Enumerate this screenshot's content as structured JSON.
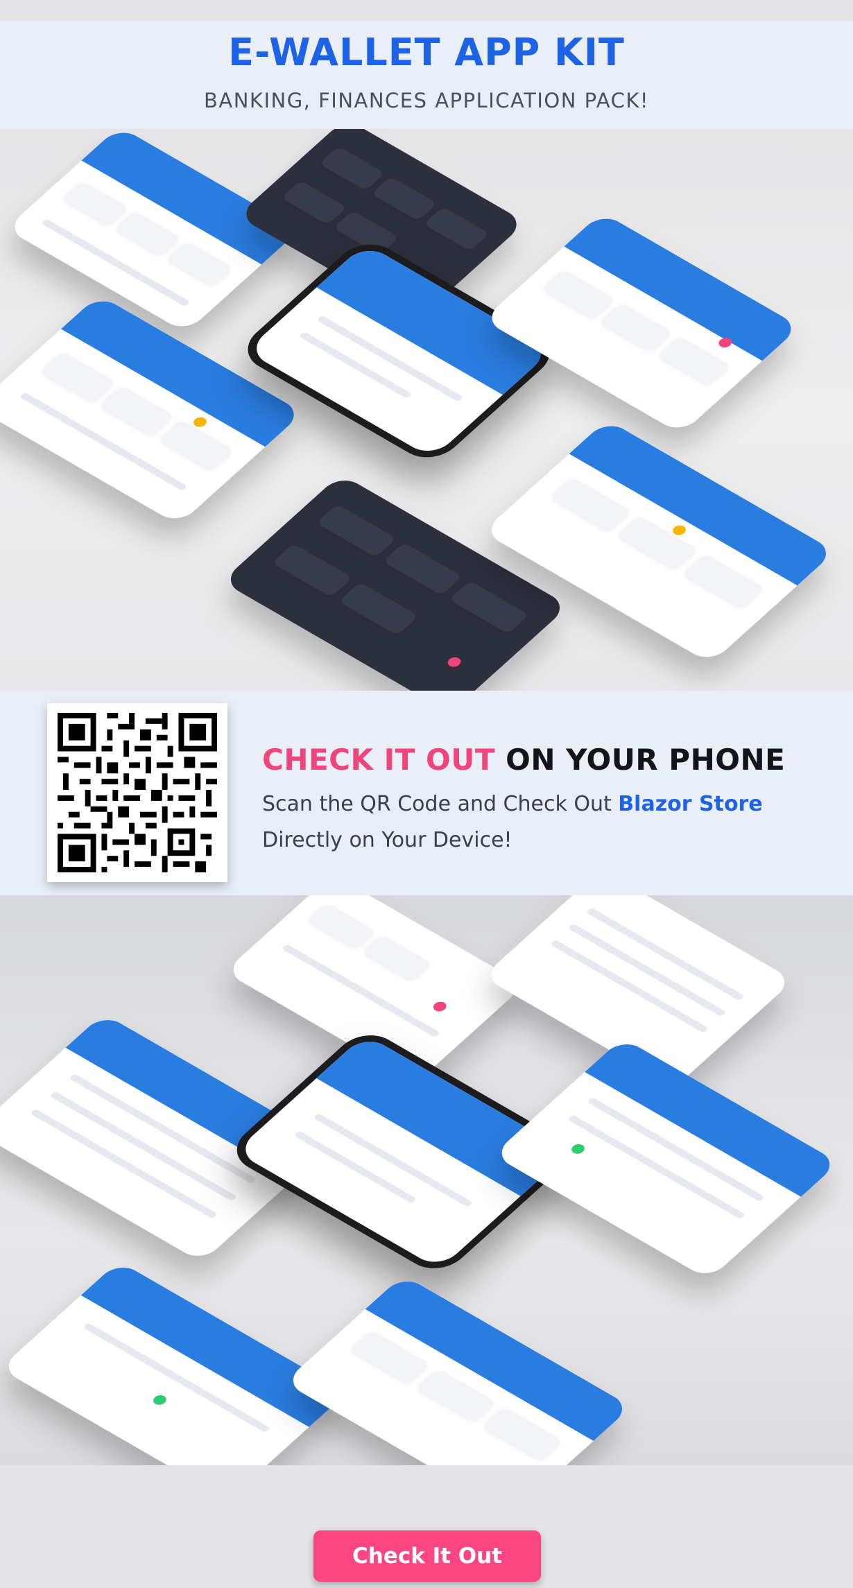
{
  "header": {
    "title": "E-WALLET APP KIT",
    "subtitle": "BANKING, FINANCES APPLICATION PACK!"
  },
  "qr": {
    "headline_highlight": "CHECK IT OUT",
    "headline_rest": " ON YOUR PHONE",
    "text_part1": "Scan the QR Code and Check Out ",
    "brand": "Blazor Store",
    "text_part2": "Directly on Your Device!"
  },
  "footer": {
    "cta_label": "Check It Out"
  },
  "colors": {
    "accent_blue": "#1e63e6",
    "app_blue": "#2a7de0",
    "highlight_pink": "#f0457a",
    "button_pink": "#fb4682",
    "band_bg": "#e9eef7"
  }
}
